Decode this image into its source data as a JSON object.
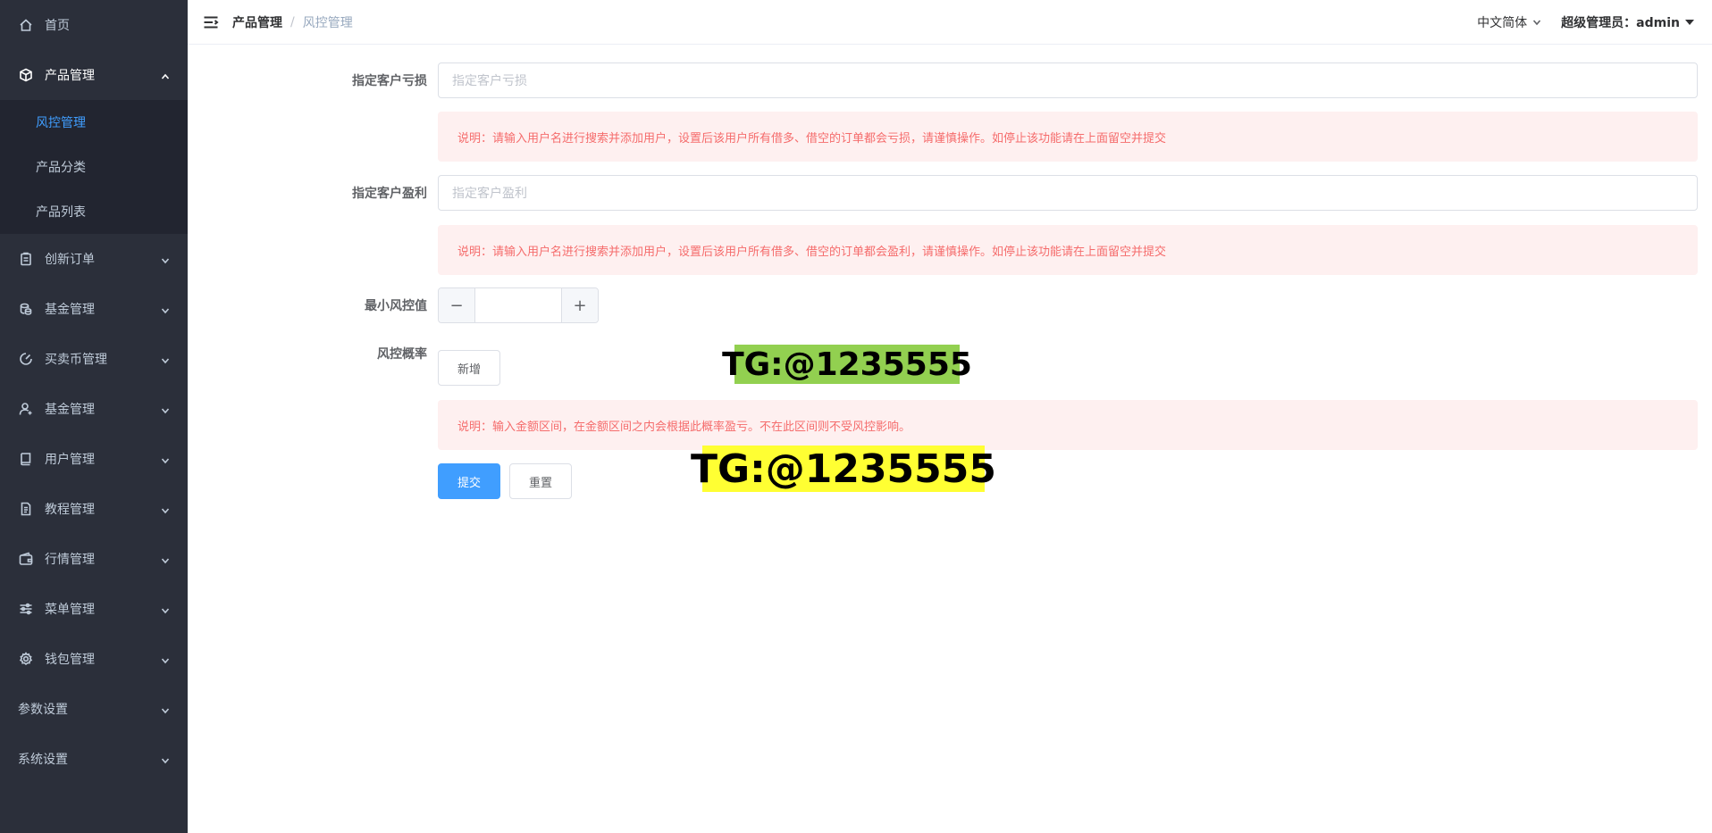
{
  "sidebar": {
    "items": [
      {
        "label": "首页",
        "icon": "home-icon",
        "has_children": false
      },
      {
        "label": "产品管理",
        "icon": "box-icon",
        "expanded": true
      },
      {
        "label": "创新订单",
        "icon": "clipboard-icon"
      },
      {
        "label": "基金管理",
        "icon": "coins-icon"
      },
      {
        "label": "买卖币管理",
        "icon": "gauge-icon"
      },
      {
        "label": "基金管理",
        "icon": "user-icon"
      },
      {
        "label": "用户管理",
        "icon": "book-icon"
      },
      {
        "label": "教程管理",
        "icon": "document-icon"
      },
      {
        "label": "行情管理",
        "icon": "wallet-icon"
      },
      {
        "label": "菜单管理",
        "icon": "sliders-icon"
      },
      {
        "label": "钱包管理",
        "icon": "gear-icon"
      },
      {
        "label": "参数设置"
      },
      {
        "label": "系统设置"
      }
    ],
    "submenu": [
      {
        "label": "风控管理",
        "active": true
      },
      {
        "label": "产品分类"
      },
      {
        "label": "产品列表"
      }
    ]
  },
  "header": {
    "breadcrumb": [
      "产品管理",
      "风控管理"
    ],
    "language": "中文简体",
    "user": "超级管理员：admin"
  },
  "form": {
    "loss_label": "指定客户亏损",
    "loss_placeholder": "指定客户亏损",
    "loss_note": "说明：请输入用户名进行搜索并添加用户，设置后该用户所有借多、借空的订单都会亏损，请谨慎操作。如停止该功能请在上面留空并提交",
    "profit_label": "指定客户盈利",
    "profit_placeholder": "指定客户盈利",
    "profit_note": "说明：请输入用户名进行搜索并添加用户，设置后该用户所有借多、借空的订单都会盈利，请谨慎操作。如停止该功能请在上面留空并提交",
    "min_label": "最小风控值",
    "min_value": "",
    "minus": "−",
    "plus": "+",
    "prob_label": "风控概率",
    "add_button": "新增",
    "prob_note": "说明：输入金额区间，在金额区间之内会根据此概率盈亏。不在此区间则不受风控影响。",
    "submit_button": "提交",
    "reset_button": "重置"
  },
  "watermarks": [
    {
      "text": "TG:@1235555",
      "color": "#92d050"
    },
    {
      "text": "TG:@1235555",
      "color": "#ffff33"
    }
  ]
}
